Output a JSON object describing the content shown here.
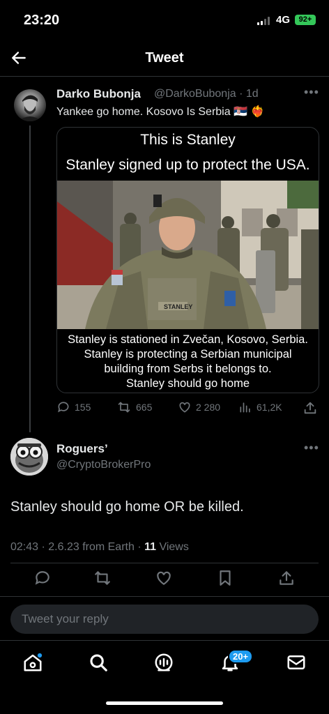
{
  "status_bar": {
    "time": "23:20",
    "network": "4G",
    "battery": "92+"
  },
  "header": {
    "title": "Tweet"
  },
  "tweet1": {
    "author_name": "Darko Bubonja",
    "handle_time": "@DarkoBubonja · 1d",
    "text": "Yankee go home. Kosovo Is Serbia 🇷🇸 ❤️‍🔥",
    "meme": {
      "top_line_1": "This is Stanley",
      "top_line_2": "Stanley signed up to protect the USA.",
      "bottom_line_1": "Stanley is stationed in Zvečan, Kosovo, Serbia.",
      "bottom_line_2": "Stanley is protecting a Serbian municipal",
      "bottom_line_3": "building from Serbs it belongs to.",
      "bottom_line_4": "Stanley should go home",
      "name_tape": "STANLEY"
    },
    "stats": {
      "replies": "155",
      "retweets": "665",
      "likes": "2 280",
      "views": "61,2K"
    }
  },
  "tweet2": {
    "author_name": "Roguers’",
    "handle": "@CryptoBrokerPro",
    "text": "Stanley should go home OR be killed.",
    "meta_prefix": "02:43 · 2.6.23 from Earth · ",
    "views_count": "11",
    "views_label": " Views"
  },
  "reply": {
    "placeholder": "Tweet your reply"
  },
  "bottom_nav": {
    "notifications_badge": "20+"
  },
  "colors": {
    "accent": "#1d9bf0",
    "muted": "#71767b",
    "battery": "#34c759"
  }
}
